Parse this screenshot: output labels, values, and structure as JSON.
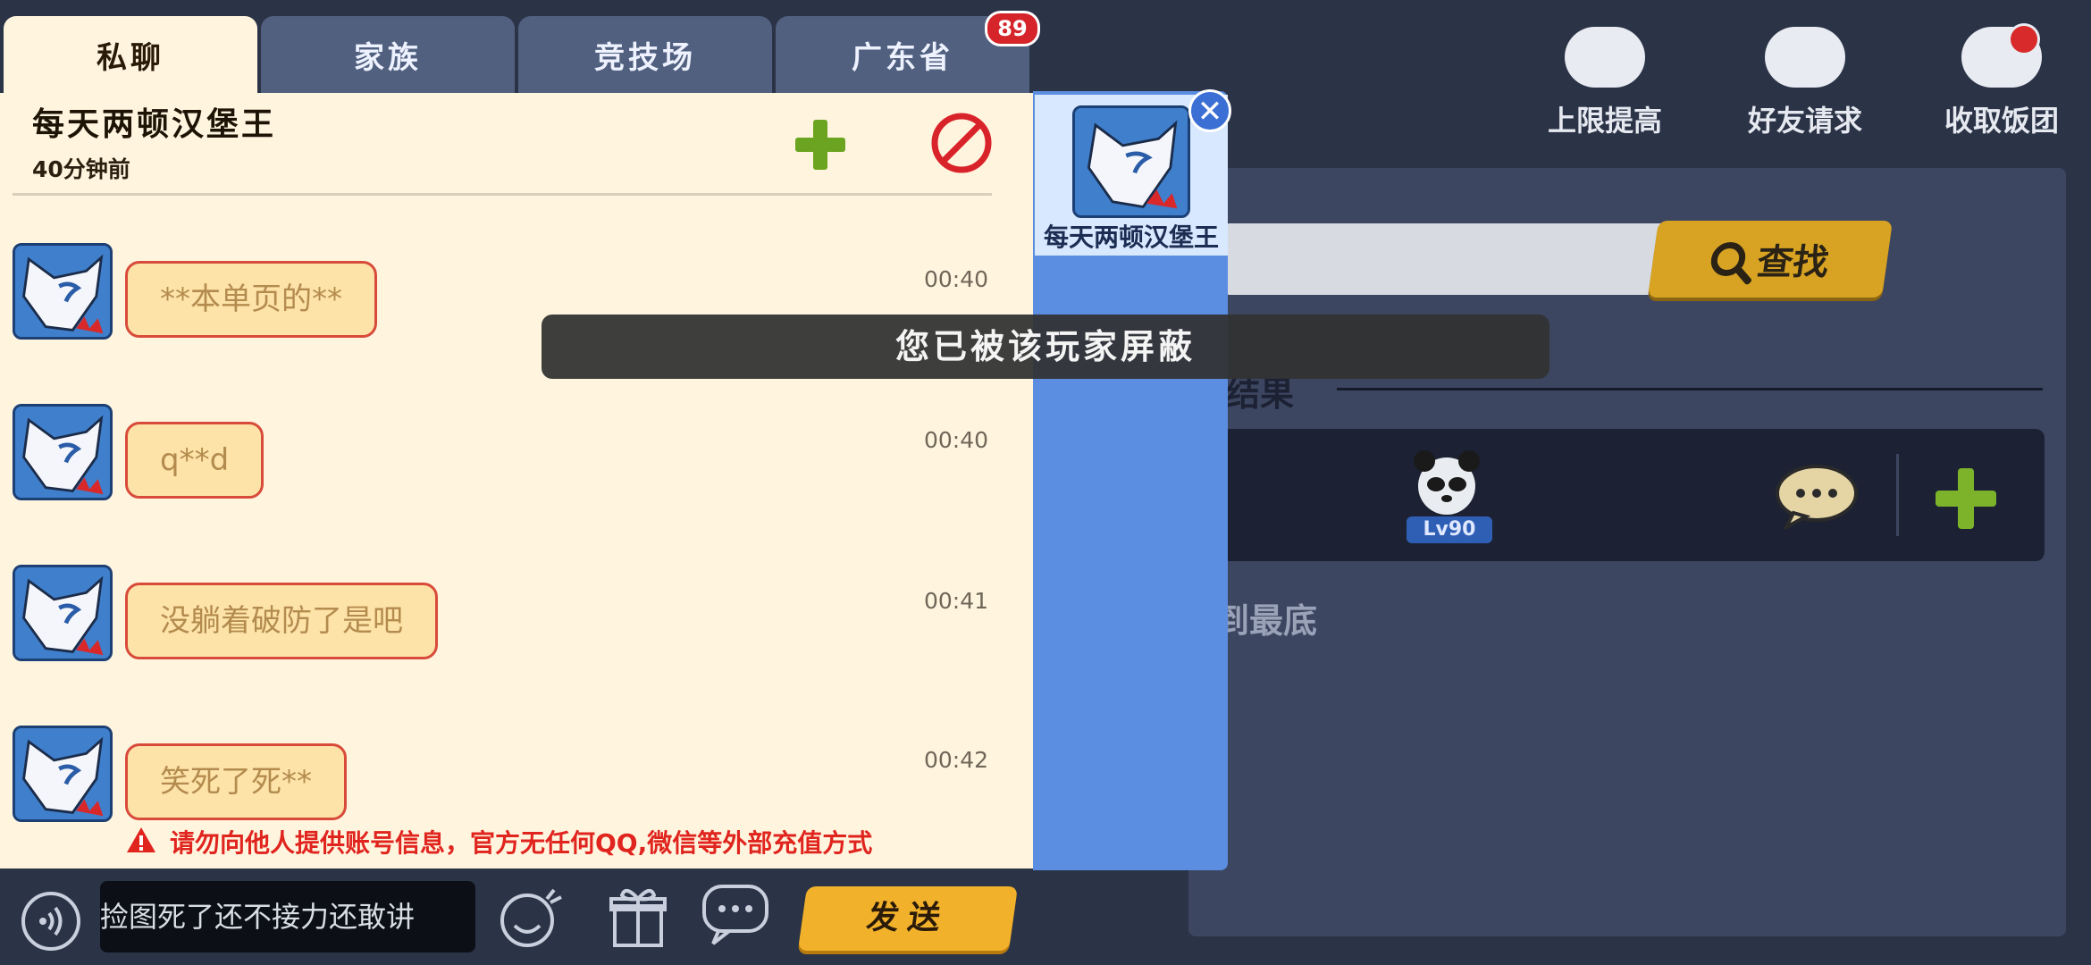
{
  "tabs": [
    {
      "label": "私聊",
      "active": true
    },
    {
      "label": "家族",
      "active": false
    },
    {
      "label": "竞技场",
      "active": false
    },
    {
      "label": "广东省",
      "active": false
    }
  ],
  "tab_badge": "89",
  "chat_header": {
    "name": "每天两顿汉堡王",
    "last_seen": "40分钟前"
  },
  "messages": [
    {
      "text": "**本单页的**",
      "time": "00:40"
    },
    {
      "text": "q**d",
      "time": "00:40"
    },
    {
      "text": "没躺着破防了是吧",
      "time": "00:41"
    },
    {
      "text": "笑死了死**",
      "time": "00:42"
    }
  ],
  "warning": "请勿向他人提供账号信息，官方无任何QQ,微信等外部充值方式",
  "input": {
    "value": "捡图死了还不接力还敢讲"
  },
  "send_label": "发送",
  "contact": {
    "name": "每天两顿汉堡王"
  },
  "toast": "您已被该玩家屏蔽",
  "top_actions": [
    {
      "label": "上限提高",
      "icon": "rabbit-icon"
    },
    {
      "label": "好友请求",
      "icon": "soap-icon"
    },
    {
      "label": "收取饭团",
      "icon": "rice-ball-icon"
    }
  ],
  "search": {
    "button_label": "查找"
  },
  "result": {
    "label": "结果",
    "level": "Lv90"
  },
  "bottom_text": "到最底",
  "colors": {
    "accent_gold": "#f2b12b",
    "tab_blue": "#51607f",
    "chat_bg": "#fff5df",
    "contact_blue": "#5b8ee0"
  }
}
